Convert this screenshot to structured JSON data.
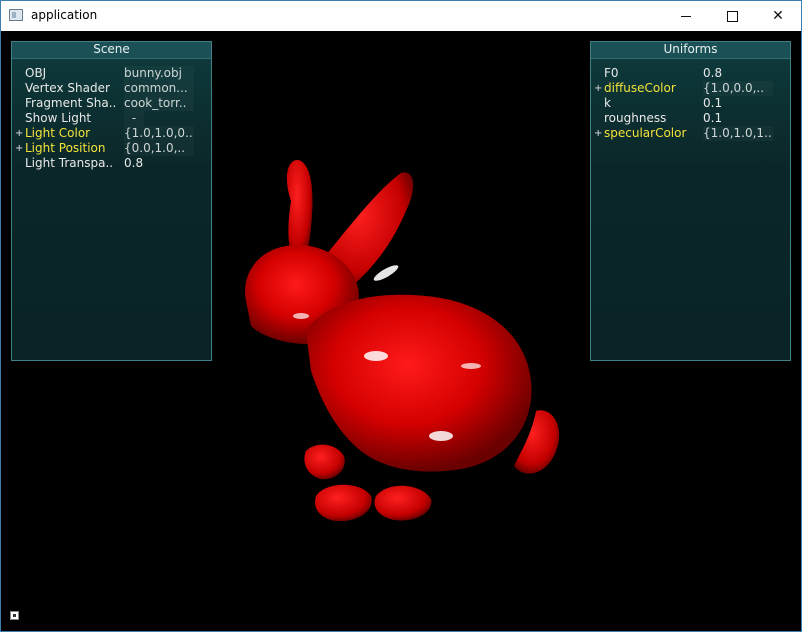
{
  "window": {
    "title": "application",
    "icon": "app-window-icon",
    "controls": {
      "minimize": "minimize-icon",
      "maximize": "maximize-icon",
      "close": "✕"
    }
  },
  "scene_panel": {
    "title": "Scene",
    "rows": [
      {
        "expander": "",
        "label": "OBJ",
        "value": "bunny.obj",
        "highlight": false
      },
      {
        "expander": "",
        "label": "Vertex Shader",
        "value": "common...",
        "highlight": false
      },
      {
        "expander": "",
        "label": "Fragment Sha..",
        "value": "cook_torr..",
        "highlight": false
      },
      {
        "expander": "",
        "label": "Show Light",
        "value": "-",
        "highlight": false
      },
      {
        "expander": "+",
        "label": "Light Color",
        "value": "{1.0,1.0,0..",
        "highlight": true
      },
      {
        "expander": "+",
        "label": "Light Position",
        "value": "{0.0,1.0,..",
        "highlight": true
      },
      {
        "expander": "",
        "label": "Light Transpa..",
        "value": "0.8",
        "highlight": false
      }
    ]
  },
  "uniforms_panel": {
    "title": "Uniforms",
    "rows": [
      {
        "expander": "",
        "label": "F0",
        "value": "0.8",
        "highlight": false
      },
      {
        "expander": "+",
        "label": "diffuseColor",
        "value": "{1.0,0.0,..",
        "highlight": true
      },
      {
        "expander": "",
        "label": "k",
        "value": "0.1",
        "highlight": false
      },
      {
        "expander": "",
        "label": "roughness",
        "value": "0.1",
        "highlight": false
      },
      {
        "expander": "+",
        "label": "specularColor",
        "value": "{1.0,1.0,1..",
        "highlight": true
      }
    ]
  },
  "render": {
    "object_color": "#e00000",
    "highlight_color": "#ffffff",
    "background": "#000000"
  },
  "status": {
    "corner_icon": "resize-grip-icon"
  }
}
